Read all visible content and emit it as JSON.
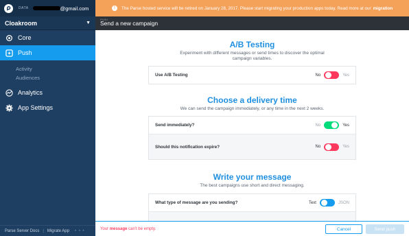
{
  "sidebar": {
    "data_label": "DATA",
    "email_suffix": "@gmail.com",
    "app_name": "Cloakroom",
    "nav": {
      "core": "Core",
      "push": "Push",
      "analytics": "Analytics",
      "app_settings": "App Settings"
    },
    "sub_items": [
      "Activity",
      "Audiences"
    ],
    "footer_links": {
      "docs": "Parse Server Docs",
      "migrate": "Migrate App",
      "dots": "• • •"
    }
  },
  "banner": {
    "icon": "warning-icon",
    "text": "The Parse hosted service will be retired on January 28, 2017. Please start migrating your production apps today. Read more at our",
    "link": "migration"
  },
  "header": {
    "small_label": "PUSH",
    "title": "Send a new campaign"
  },
  "ab_testing": {
    "title": "A/B Testing",
    "description_line1": "Experiment with different messages or send times to discover the optimal",
    "description_line2": "campaign variables.",
    "row_label": "Use A/B Testing",
    "off_label": "No",
    "on_label": "Yes"
  },
  "delivery": {
    "title": "Choose a delivery time",
    "description": "We can send the campaign immediately, or any time in the next 2 weeks.",
    "send_immediately": {
      "label": "Send immediately?",
      "off_label": "No",
      "on_label": "Yes"
    },
    "expire": {
      "label": "Should this notification expire?",
      "off_label": "No",
      "on_label": "Yes"
    }
  },
  "message": {
    "title": "Write your message",
    "description": "The best campaigns use short and direct messaging.",
    "type_question": "What type of message are you sending?",
    "left_label": "Text",
    "right_label": "JSON"
  },
  "footer": {
    "error_prefix": "Your",
    "error_bold": "message",
    "error_suffix": "can't be empty.",
    "cancel_label": "Cancel",
    "send_label": "Send push"
  },
  "colors": {
    "sidebar_bg": "#1f3f62",
    "accent_blue": "#169cee",
    "banner_orange": "#f4a15a",
    "toggle_red": "#ff395e",
    "toggle_green": "#00db7c",
    "title_blue": "#1f8fe0"
  }
}
